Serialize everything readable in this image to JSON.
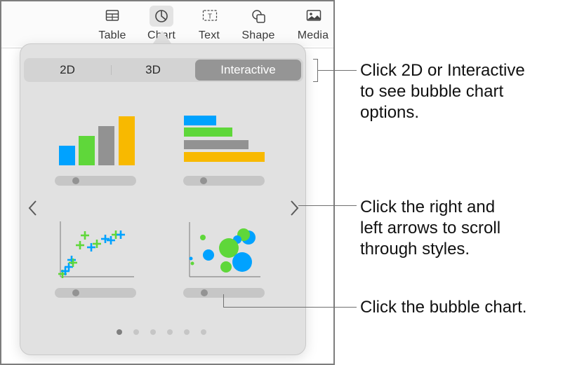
{
  "toolbar": {
    "items": [
      {
        "label": "Table",
        "icon": "table-icon",
        "active": false
      },
      {
        "label": "Chart",
        "icon": "chart-icon",
        "active": true
      },
      {
        "label": "Text",
        "icon": "text-box-icon",
        "active": false
      },
      {
        "label": "Shape",
        "icon": "shape-icon",
        "active": false
      },
      {
        "label": "Media",
        "icon": "media-icon",
        "active": false
      }
    ]
  },
  "popover": {
    "segments": [
      {
        "label": "2D",
        "selected": false
      },
      {
        "label": "3D",
        "selected": false
      },
      {
        "label": "Interactive",
        "selected": true
      }
    ],
    "thumbnails": [
      {
        "type": "column",
        "name": "column-chart"
      },
      {
        "type": "bar",
        "name": "bar-chart"
      },
      {
        "type": "scatter",
        "name": "scatter-chart"
      },
      {
        "type": "bubble",
        "name": "bubble-chart"
      }
    ],
    "page_dots": {
      "count": 6,
      "active_index": 0
    },
    "nav": {
      "prev": "chevron-left-icon",
      "next": "chevron-right-icon"
    }
  },
  "colors": {
    "blue": "#00a2ff",
    "green": "#5fd73a",
    "gray": "#929292",
    "yellow": "#f8b900",
    "selected_segment": "#959595",
    "popover_bg": "#e1e1e1"
  },
  "callouts": [
    {
      "lines": [
        "Click 2D or Interactive",
        "to see bubble chart",
        "options."
      ]
    },
    {
      "lines": [
        "Click the right and",
        "left arrows to scroll",
        "through styles."
      ]
    },
    {
      "lines": [
        "Click the bubble chart."
      ]
    }
  ]
}
